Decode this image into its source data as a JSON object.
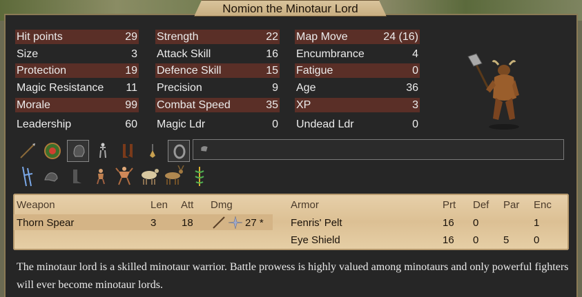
{
  "title": "Nomion the Minotaur Lord",
  "stats": {
    "col1": [
      {
        "label": "Hit points",
        "value": "29"
      },
      {
        "label": "Size",
        "value": "3"
      },
      {
        "label": "Protection",
        "value": "19"
      },
      {
        "label": "Magic Resistance",
        "value": "11"
      },
      {
        "label": "Morale",
        "value": "99"
      },
      {
        "label": "Leadership",
        "value": "60"
      }
    ],
    "col2": [
      {
        "label": "Strength",
        "value": "22"
      },
      {
        "label": "Attack Skill",
        "value": "16"
      },
      {
        "label": "Defence Skill",
        "value": "15"
      },
      {
        "label": "Precision",
        "value": "9"
      },
      {
        "label": "Combat Speed",
        "value": "35"
      },
      {
        "label": "Magic Ldr",
        "value": "0"
      }
    ],
    "col3": [
      {
        "label": "Map Move",
        "value": "24 (16)"
      },
      {
        "label": "Encumbrance",
        "value": "4"
      },
      {
        "label": "Fatigue",
        "value": "0"
      },
      {
        "label": "Age",
        "value": "36"
      },
      {
        "label": "XP",
        "value": "3"
      },
      {
        "label": "Undead Ldr",
        "value": "0"
      }
    ]
  },
  "slot_icons": [
    "spear-icon",
    "shield-ring-icon",
    "helmet-icon",
    "body-armor-icon",
    "boots-icon",
    "amulet-icon",
    "ring-icon",
    "misc-item-icon"
  ],
  "ability_icons": [
    "winter-icon",
    "spirit-wolf-icon",
    "boot-icon",
    "warrior-icon",
    "berserker-icon",
    "ram-icon",
    "stag-icon",
    "caduceus-icon"
  ],
  "weapons": {
    "headers": {
      "name": "Weapon",
      "len": "Len",
      "att": "Att",
      "dmg": "Dmg"
    },
    "rows": [
      {
        "name": "Thorn Spear",
        "len": "3",
        "att": "18",
        "dmg": "27 *"
      }
    ]
  },
  "armor": {
    "headers": {
      "name": "Armor",
      "prt": "Prt",
      "def": "Def",
      "par": "Par",
      "enc": "Enc"
    },
    "rows": [
      {
        "name": "Fenris' Pelt",
        "prt": "16",
        "def": "0",
        "par": "",
        "enc": "1"
      },
      {
        "name": "Eye Shield",
        "prt": "16",
        "def": "0",
        "par": "5",
        "enc": "0"
      }
    ]
  },
  "description": "The minotaur lord is a skilled minotaur warrior. Battle prowess is highly valued among minotaurs and only powerful fighters will ever become minotaur lords.",
  "colors": {
    "highlight": "#5a2f27",
    "panel": "#262626",
    "parchment": "#e2c89c"
  }
}
